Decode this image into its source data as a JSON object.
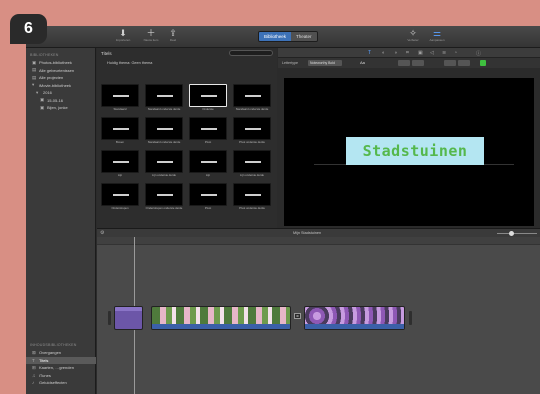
{
  "step_badge": "6",
  "toolbar": {
    "items": [
      {
        "icon": "download-icon",
        "glyph": "⬇",
        "label": "Importeren"
      },
      {
        "icon": "plus-icon",
        "glyph": "＋",
        "label": "Nieuw item"
      },
      {
        "icon": "share-icon",
        "glyph": "⇪",
        "label": "Deel"
      }
    ],
    "segments": [
      "Bibliotheek",
      "Theater"
    ],
    "right_items": [
      {
        "icon": "sparkle-icon",
        "glyph": "✧",
        "label": "Verbeter"
      },
      {
        "icon": "sliders-icon",
        "glyph": "⚌",
        "label": "Aanpassen"
      }
    ]
  },
  "sidebar": {
    "libraries_header": "BIBLIOTHEKEN",
    "items": [
      {
        "icon": "photo-icon",
        "glyph": "▣",
        "label": "Photos-bibliotheek"
      },
      {
        "icon": "film-icon",
        "glyph": "▤",
        "label": "Alle gebeurtenissen"
      },
      {
        "icon": "film-icon",
        "glyph": "▤",
        "label": "Alle projecten"
      },
      {
        "icon": "star-icon",
        "glyph": "▾",
        "label": "iMovie-bibliotheek"
      },
      {
        "icon": "folder-icon",
        "glyph": "▾",
        "label": "2016"
      },
      {
        "icon": "calendar-icon",
        "glyph": "▣",
        "label": "15-05-16"
      },
      {
        "icon": "calendar-icon",
        "glyph": "▣",
        "label": "Bijen, jonke"
      }
    ],
    "content_header": "INHOUDSBIBLIOTHEKEN",
    "content_items": [
      {
        "icon": "transition-icon",
        "glyph": "⊠",
        "label": "Overgangen",
        "selected": false
      },
      {
        "icon": "title-icon",
        "glyph": "T",
        "label": "Titels",
        "selected": true
      },
      {
        "icon": "map-icon",
        "glyph": "⊞",
        "label": "Kaarten, …grenden",
        "selected": false
      },
      {
        "icon": "music-icon",
        "glyph": "♫",
        "label": "iTunes",
        "selected": false
      },
      {
        "icon": "sound-icon",
        "glyph": "♪",
        "label": "Geluidseffecten",
        "selected": false
      }
    ]
  },
  "browser": {
    "title": "Titels",
    "filter": "Huidig thema: Geen thema",
    "tiles": [
      "Standaard",
      "Standaard onderste derde",
      "Onderste",
      "Standaard onderste derde",
      "Boven",
      "Standaard onderste derde",
      "Pivot",
      "Pivot onderste derde",
      "Lijn",
      "Lijn onderste derde",
      "Lijn",
      "Lijn onderste derde",
      "Onderstrepen",
      "Onderstrepen onderste derde",
      "Pivot",
      "Pivot onderste derde"
    ],
    "selected_tile": 2
  },
  "viewer": {
    "options_label": "Lettertype",
    "font_select": "Noteworthy Bold",
    "font_style": "Aa",
    "title_text": "Stadstuinen",
    "title_bg": "#b4e6f2",
    "title_color": "#55b84c"
  },
  "timeline": {
    "project_label": "Mijn Stadstuinen",
    "transition_glyph": "⊠"
  }
}
